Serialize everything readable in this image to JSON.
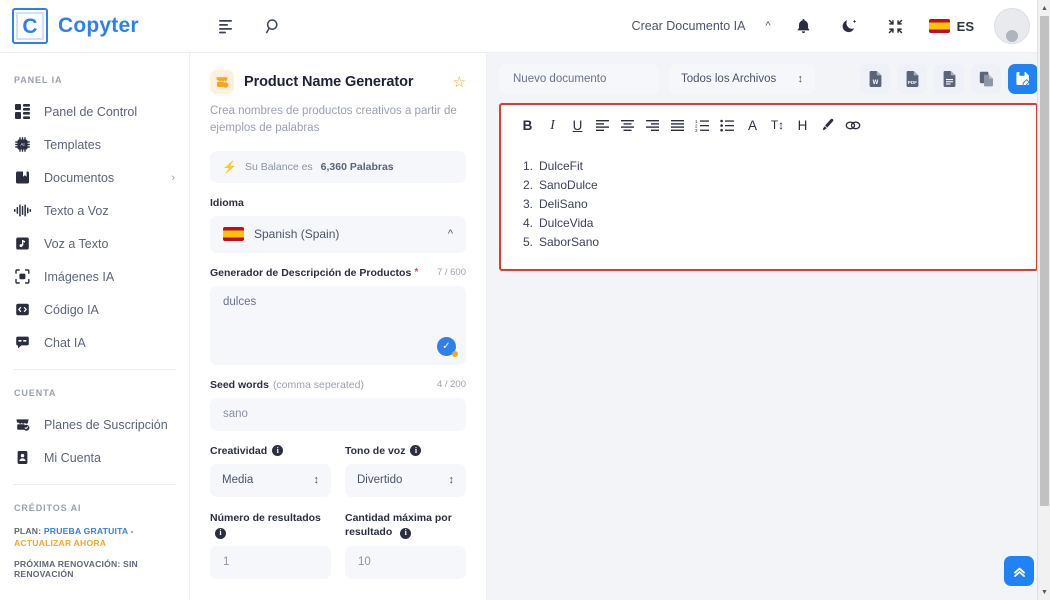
{
  "brand": {
    "mark": "C",
    "name": "Copyter"
  },
  "topbar": {
    "menu_icon": "menu-icon",
    "search_icon": "search-icon",
    "create_doc_label": "Crear Documento IA",
    "collapse_icon": "chevron-up-icon",
    "bell_icon": "bell-icon",
    "theme_icon": "moon-icon",
    "fullscreen_icon": "compress-icon",
    "language_code": "ES",
    "flag_icon": "spain-flag-icon",
    "avatar_icon": "user-avatar"
  },
  "sidebar": {
    "section_panel": "PANEL IA",
    "items": [
      {
        "label": "Panel de Control",
        "icon": "dashboard-icon",
        "caret": ""
      },
      {
        "label": "Templates",
        "icon": "chip-icon",
        "caret": ""
      },
      {
        "label": "Documentos",
        "icon": "book-icon",
        "caret": "›"
      },
      {
        "label": "Texto a Voz",
        "icon": "waveform-icon",
        "caret": ""
      },
      {
        "label": "Voz a Texto",
        "icon": "audio-file-icon",
        "caret": ""
      },
      {
        "label": "Imágenes IA",
        "icon": "camera-icon",
        "caret": ""
      },
      {
        "label": "Código IA",
        "icon": "code-icon",
        "caret": ""
      },
      {
        "label": "Chat IA",
        "icon": "chat-icon",
        "caret": ""
      }
    ],
    "section_account": "CUENTA",
    "account_items": [
      {
        "label": "Planes de Suscripción",
        "icon": "shop-icon"
      },
      {
        "label": "Mi Cuenta",
        "icon": "id-card-icon"
      }
    ],
    "section_credits": "CRÉDITOS AI",
    "plan_prefix": "PLAN:",
    "plan_name": "PRUEBA GRATUITA",
    "plan_dash": "-",
    "plan_action": "ACTUALIZAR AHORA",
    "renewal": "PRÓXIMA RENOVACIÓN: SIN RENOVACIÓN"
  },
  "form": {
    "icon": "gift-shop-icon",
    "title": "Product Name Generator",
    "favorite_icon": "star-outline-icon",
    "subtitle": "Crea nombres de productos creativos a partir de ejemplos de palabras",
    "balance_icon": "bolt-icon",
    "balance_prefix": "Su Balance es",
    "balance_value": "6,360 Palabras",
    "language_label": "Idioma",
    "language_value": "Spanish (Spain)",
    "language_flag": "spain-flag-icon",
    "desc_label": "Generador de Descripción de Productos",
    "desc_required": "*",
    "desc_counter": "7 / 600",
    "desc_value": "dulces",
    "desc_check_icon": "check-circle-icon",
    "seed_label": "Seed words",
    "seed_label_muted": "(comma seperated)",
    "seed_counter": "4 / 200",
    "seed_value": "sano",
    "creativity_label": "Creatividad",
    "creativity_value": "Media",
    "tone_label": "Tono de voz",
    "tone_value": "Divertido",
    "results_label": "Número de resultados",
    "results_value": "1",
    "maxqty_label": "Cantidad máxima por resultado",
    "maxqty_value": "10"
  },
  "editor": {
    "doc_name_value": "Nuevo documento",
    "files_filter_value": "Todos los Archivos",
    "export_buttons": [
      {
        "icon": "word-file-icon",
        "label": "W"
      },
      {
        "icon": "pdf-file-icon",
        "label": "PDF"
      },
      {
        "icon": "text-file-icon",
        "label": ""
      },
      {
        "icon": "copy-icon",
        "label": ""
      },
      {
        "icon": "save-document-icon",
        "label": ""
      }
    ],
    "format_buttons": [
      {
        "icon": "bold-icon",
        "glyph": "B"
      },
      {
        "icon": "italic-icon",
        "glyph": "I"
      },
      {
        "icon": "underline-icon",
        "glyph": "U"
      },
      {
        "icon": "align-left-icon",
        "glyph": ""
      },
      {
        "icon": "align-center-icon",
        "glyph": ""
      },
      {
        "icon": "align-right-icon",
        "glyph": ""
      },
      {
        "icon": "align-justify-icon",
        "glyph": ""
      },
      {
        "icon": "ordered-list-icon",
        "glyph": ""
      },
      {
        "icon": "unordered-list-icon",
        "glyph": ""
      },
      {
        "icon": "font-color-icon",
        "glyph": "A"
      },
      {
        "icon": "font-size-icon",
        "glyph": "T↕"
      },
      {
        "icon": "heading-icon",
        "glyph": "H"
      },
      {
        "icon": "highlight-icon",
        "glyph": ""
      },
      {
        "icon": "link-icon",
        "glyph": ""
      }
    ],
    "document_items": [
      {
        "num": "1.",
        "text": "DulceFit"
      },
      {
        "num": "2.",
        "text": "SanoDulce"
      },
      {
        "num": "3.",
        "text": "DeliSano"
      },
      {
        "num": "4.",
        "text": "DulceVida"
      },
      {
        "num": "5.",
        "text": "SaborSano"
      }
    ],
    "scroll_top_icon": "chevron-double-up-icon",
    "highlight_color": "#e8362b"
  },
  "colors": {
    "brand_blue": "#2f80ed",
    "accent_blue": "#1f82f5",
    "accent_orange": "#f5a623",
    "highlight_red": "#e8362b",
    "bg_gray": "#f2f4f8",
    "field_gray": "#f5f7fa"
  }
}
